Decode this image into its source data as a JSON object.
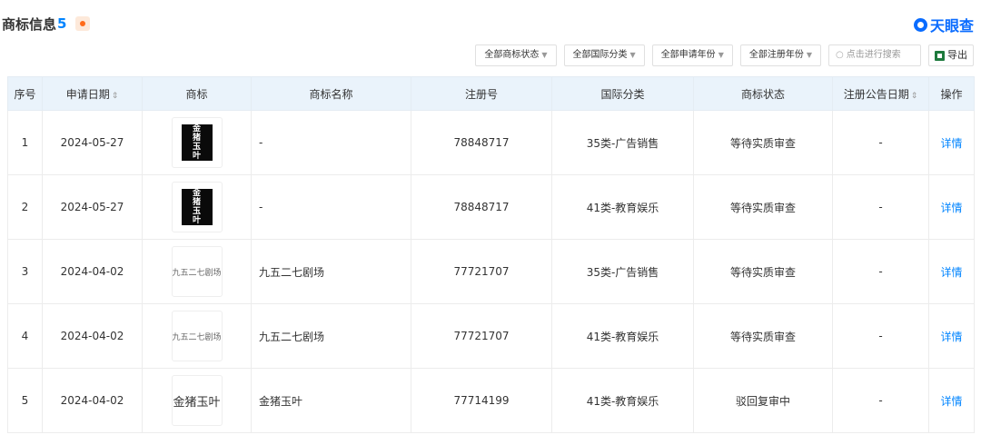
{
  "header": {
    "title": "商标信息",
    "count": "5"
  },
  "brand": {
    "name": "天眼查"
  },
  "filters": {
    "status": "全部商标状态",
    "intl_class": "全部国际分类",
    "apply_year": "全部申请年份",
    "reg_year": "全部注册年份",
    "search_placeholder": "点击进行搜索",
    "export": "导出"
  },
  "table": {
    "columns": [
      "序号",
      "申请日期",
      "商标",
      "商标名称",
      "注册号",
      "国际分类",
      "商标状态",
      "注册公告日期",
      "操作"
    ],
    "sortable": [
      "申请日期",
      "注册公告日期"
    ],
    "rows": [
      {
        "index": "1",
        "date": "2024-05-27",
        "logo": "金猪玉叶",
        "logo_style": "black",
        "name": "-",
        "reg_no": "78848717",
        "class": "35类-广告销售",
        "status": "等待实质审查",
        "notice_date": "-",
        "action": "详情"
      },
      {
        "index": "2",
        "date": "2024-05-27",
        "logo": "金猪玉叶",
        "logo_style": "black",
        "name": "-",
        "reg_no": "78848717",
        "class": "41类-教育娱乐",
        "status": "等待实质审查",
        "notice_date": "-",
        "action": "详情"
      },
      {
        "index": "3",
        "date": "2024-04-02",
        "logo": "九五二七剧场",
        "logo_style": "text",
        "name": "九五二七剧场",
        "reg_no": "77721707",
        "class": "35类-广告销售",
        "status": "等待实质审查",
        "notice_date": "-",
        "action": "详情"
      },
      {
        "index": "4",
        "date": "2024-04-02",
        "logo": "九五二七剧场",
        "logo_style": "text",
        "name": "九五二七剧场",
        "reg_no": "77721707",
        "class": "41类-教育娱乐",
        "status": "等待实质审查",
        "notice_date": "-",
        "action": "详情"
      },
      {
        "index": "5",
        "date": "2024-04-02",
        "logo": "金猪玉叶",
        "logo_style": "textbig",
        "name": "金猪玉叶",
        "reg_no": "77714199",
        "class": "41类-教育娱乐",
        "status": "驳回复审中",
        "notice_date": "-",
        "action": "详情"
      }
    ]
  },
  "colors": {
    "accent": "#0084ff",
    "brand": "#0a6cff",
    "header_bg": "#eaf3fb"
  }
}
